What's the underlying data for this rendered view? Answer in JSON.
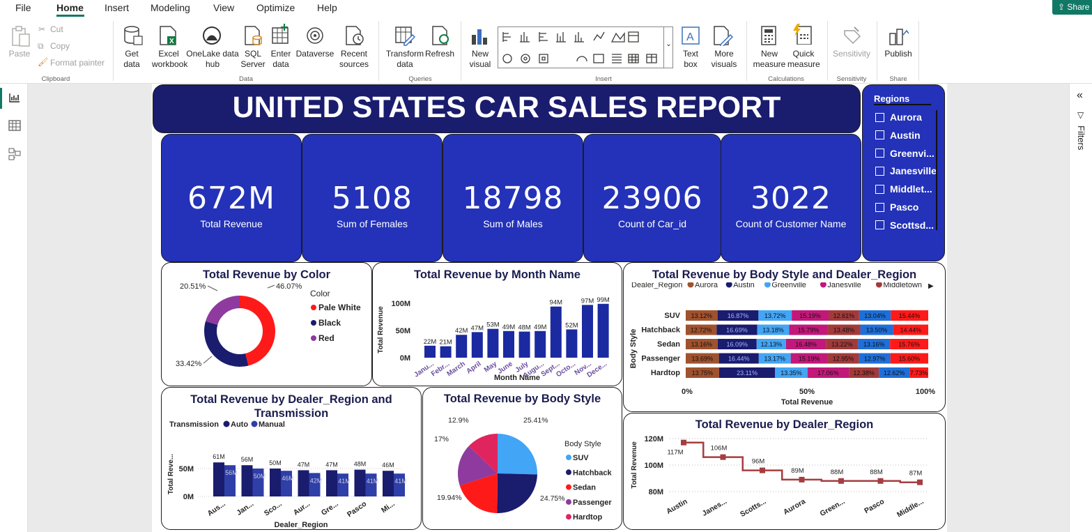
{
  "menu": {
    "file": "File",
    "home": "Home",
    "insert": "Insert",
    "modeling": "Modeling",
    "view": "View",
    "optimize": "Optimize",
    "help": "Help",
    "share": "Share"
  },
  "ribbon": {
    "paste": "Paste",
    "cut": "Cut",
    "copy": "Copy",
    "format_painter": "Format painter",
    "get_data": "Get data",
    "excel": "Excel workbook",
    "onelake": "OneLake data hub",
    "sql": "SQL Server",
    "enter_data": "Enter data",
    "dataverse": "Dataverse",
    "recent": "Recent sources",
    "transform": "Transform data",
    "refresh": "Refresh",
    "new_visual": "New visual",
    "text_box": "Text box",
    "more_visuals": "More visuals",
    "new_measure": "New measure",
    "quick_measure": "Quick measure",
    "sensitivity": "Sensitivity",
    "publish": "Publish",
    "groups": {
      "clipboard": "Clipboard",
      "data": "Data",
      "queries": "Queries",
      "insert": "Insert",
      "calculations": "Calculations",
      "sensitivity": "Sensitivity",
      "share": "Share"
    }
  },
  "filters_label": "Filters",
  "report": {
    "title": "UNITED STATES CAR SALES REPORT",
    "kpis": [
      {
        "value": "672M",
        "label": "Total Revenue"
      },
      {
        "value": "5108",
        "label": "Sum of Females"
      },
      {
        "value": "18798",
        "label": "Sum of Males"
      },
      {
        "value": "23906",
        "label": "Count of Car_id"
      },
      {
        "value": "3022",
        "label": "Count of Customer Name"
      }
    ],
    "slicer": {
      "title": "Regions",
      "items": [
        "Aurora",
        "Austin",
        "Greenvi...",
        "Janesville",
        "Middlet...",
        "Pasco",
        "Scottsd..."
      ]
    }
  },
  "colors": {
    "navy": "#1a1c6e",
    "kpi_blue": "#2332b8",
    "bar_blue": "#1b2aa0",
    "red": "#ff1a1a",
    "purple": "#8e3a9e",
    "light_blue": "#42a5f5",
    "pink": "#e0245e",
    "brown": "#a0522d",
    "magenta": "#c2187a",
    "line": "#a63d40"
  },
  "chart_data": [
    {
      "type": "pie",
      "title": "Total Revenue by Color",
      "legend_title": "Color",
      "donut": true,
      "labels": [
        "Pale White",
        "Black",
        "Red"
      ],
      "values": [
        46.07,
        33.42,
        20.51
      ],
      "display": [
        "46.07%",
        "33.42%",
        "20.51%"
      ],
      "colors": [
        "#ff1a1a",
        "#1a1c6e",
        "#8e3a9e"
      ]
    },
    {
      "type": "bar",
      "title": "Total Revenue by Month Name",
      "xlabel": "Month Name",
      "ylabel": "Total Revenue",
      "categories": [
        "Janu...",
        "Febr...",
        "March",
        "April",
        "May",
        "June",
        "July",
        "Augu...",
        "Sept...",
        "Octo...",
        "Nov...",
        "Dece..."
      ],
      "values": [
        22,
        21,
        42,
        47,
        53,
        49,
        48,
        49,
        94,
        52,
        97,
        99
      ],
      "data_labels": [
        "22M",
        "21M",
        "42M",
        "47M",
        "53M",
        "49M",
        "48M",
        "49M",
        "94M",
        "52M",
        "97M",
        "99M"
      ],
      "yticks": [
        "100M",
        "50M",
        "0M"
      ],
      "ylim": [
        0,
        100
      ]
    },
    {
      "type": "bar",
      "stacked": "100%",
      "orientation": "horizontal",
      "title": "Total Revenue by Body Style and Dealer_Region",
      "legend_title": "Dealer_Region",
      "xlabel": "Total Revenue",
      "ylabel": "Body Style",
      "legend": [
        "Aurora",
        "Austin",
        "Greenville",
        "Janesville",
        "Middletown"
      ],
      "xticks": [
        "0%",
        "50%",
        "100%"
      ],
      "categories": [
        "SUV",
        "Hatchback",
        "Sedan",
        "Passenger",
        "Hardtop"
      ],
      "series": [
        {
          "name": "Aurora",
          "values": [
            13.12,
            12.72,
            13.16,
            13.69,
            13.75
          ]
        },
        {
          "name": "Austin",
          "values": [
            16.87,
            16.69,
            16.09,
            16.44,
            23.11
          ]
        },
        {
          "name": "Greenville",
          "values": [
            13.72,
            13.18,
            12.13,
            13.17,
            13.35
          ]
        },
        {
          "name": "Janesville",
          "values": [
            15.19,
            15.79,
            16.48,
            15.19,
            17.06
          ]
        },
        {
          "name": "Middletown",
          "values": [
            12.61,
            13.48,
            13.22,
            12.95,
            12.38
          ]
        },
        {
          "values": [
            13.04,
            13.5,
            13.16,
            12.97,
            12.62
          ]
        },
        {
          "values": [
            15.44,
            14.44,
            15.76,
            15.6,
            7.73
          ]
        }
      ]
    },
    {
      "type": "bar",
      "title": "Total Revenue by Dealer_Region and Transmission",
      "legend_title": "Transmission",
      "xlabel": "Dealer_Region",
      "ylabel": "Total Reve...",
      "categories": [
        "Aus...",
        "Jan...",
        "Sco...",
        "Aur...",
        "Gre...",
        "Pasco",
        "Mi..."
      ],
      "yticks": [
        "50M",
        "0M"
      ],
      "ylim": [
        0,
        70
      ],
      "series": [
        {
          "name": "Auto",
          "values": [
            61,
            56,
            50,
            47,
            47,
            48,
            46
          ],
          "labels": [
            "61M",
            "56M",
            "50M",
            "47M",
            "47M",
            "48M",
            "46M"
          ]
        },
        {
          "name": "Manual",
          "values": [
            56,
            50,
            46,
            42,
            41,
            41,
            41
          ],
          "labels": [
            "56M",
            "50M",
            "46M",
            "42M",
            "41M",
            "41M",
            "41M"
          ]
        }
      ]
    },
    {
      "type": "pie",
      "title": "Total Revenue by Body Style",
      "legend_title": "Body Style",
      "labels": [
        "SUV",
        "Hatchback",
        "Sedan",
        "Passenger",
        "Hardtop"
      ],
      "values": [
        25.41,
        24.75,
        19.94,
        17,
        12.9
      ],
      "display": [
        "25.41%",
        "24.75%",
        "19.94%",
        "17%",
        "12.9%"
      ],
      "colors": [
        "#42a5f5",
        "#1a1c6e",
        "#ff1a1a",
        "#8e3a9e",
        "#e0245e"
      ]
    },
    {
      "type": "line",
      "step": true,
      "title": "Total Revenue by Dealer_Region",
      "xlabel": "",
      "ylabel": "Total Revenue",
      "categories": [
        "Austin",
        "Janes...",
        "Scotts...",
        "Aurora",
        "Green...",
        "Pasco",
        "Middle..."
      ],
      "values": [
        117,
        106,
        96,
        89,
        88,
        88,
        87
      ],
      "data_labels": [
        "117M",
        "106M",
        "96M",
        "89M",
        "88M",
        "88M",
        "87M"
      ],
      "yticks": [
        "120M",
        "100M",
        "80M"
      ],
      "ylim": [
        80,
        120
      ]
    }
  ]
}
